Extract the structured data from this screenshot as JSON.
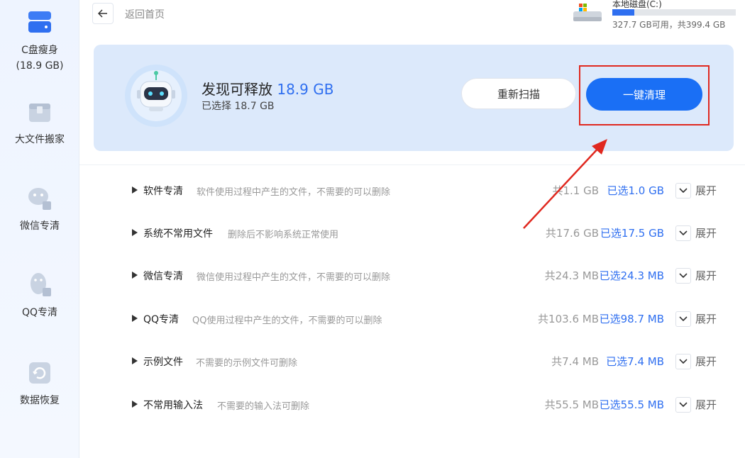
{
  "sidebar": {
    "items": [
      {
        "label": "C盘瘦身",
        "sub": "(18.9 GB)",
        "icon": "disk-icon"
      },
      {
        "label": "大文件搬家",
        "icon": "box-icon"
      },
      {
        "label": "微信专清",
        "icon": "wechat-icon"
      },
      {
        "label": "QQ专清",
        "icon": "qq-icon"
      },
      {
        "label": "数据恢复",
        "icon": "recovery-icon"
      }
    ]
  },
  "topbar": {
    "back_label": "返回首页",
    "disk": {
      "name": "本地磁盘(C:)",
      "info": "327.7 GB可用，共399.4 GB",
      "used_fraction": 0.18
    }
  },
  "summary": {
    "found_prefix": "发现可释放",
    "found_value": "18.9 GB",
    "selected_text": "已选择 18.7 GB",
    "rescan_label": "重新扫描",
    "clean_label": "一键清理"
  },
  "rows": [
    {
      "title": "软件专清",
      "desc": "软件使用过程中产生的文件，不需要的可以删除",
      "total": "共1.1 GB",
      "selected": "已选1.0 GB",
      "expand": "展开"
    },
    {
      "title": "系统不常用文件",
      "desc": "删除后不影响系统正常使用",
      "total": "共17.6 GB",
      "selected": "已选17.5 GB",
      "expand": "展开"
    },
    {
      "title": "微信专清",
      "desc": "微信使用过程中产生的文件，不需要的可以删除",
      "total": "共24.3 MB",
      "selected": "已选24.3 MB",
      "expand": "展开"
    },
    {
      "title": "QQ专清",
      "desc": "QQ使用过程中产生的文件，不需要的可以删除",
      "total": "共103.6 MB",
      "selected": "已选98.7 MB",
      "expand": "展开"
    },
    {
      "title": "示例文件",
      "desc": "不需要的示例文件可删除",
      "total": "共7.4 MB",
      "selected": "已选7.4 MB",
      "expand": "展开"
    },
    {
      "title": "不常用输入法",
      "desc": "不需要的输入法可删除",
      "total": "共55.5 MB",
      "selected": "已选55.5 MB",
      "expand": "展开"
    }
  ],
  "colors": {
    "accent": "#1a6ff5",
    "annotation": "#e0281f"
  }
}
